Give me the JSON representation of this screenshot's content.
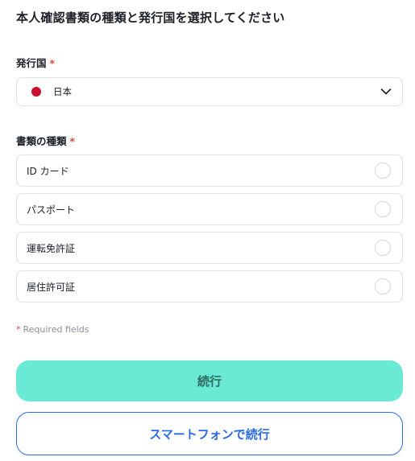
{
  "title": "本人確認書類の種類と発行国を選択してください",
  "country_field": {
    "label": "発行国",
    "required_mark": "*",
    "selected_value": "日本",
    "flag_icon": "japan-flag-icon",
    "flag_color": "#c8102e"
  },
  "document_field": {
    "label": "書類の種類",
    "required_mark": "*",
    "options": [
      {
        "label": "ID カード",
        "selected": false
      },
      {
        "label": "パスポート",
        "selected": false
      },
      {
        "label": "運転免許証",
        "selected": false
      },
      {
        "label": "居住許可証",
        "selected": false
      }
    ]
  },
  "required_note": {
    "star": "*",
    "text": "Required fields"
  },
  "buttons": {
    "continue_label": "続行",
    "smartphone_label": "スマートフォンで続行"
  },
  "colors": {
    "primary_button": "#6ae9d4",
    "secondary_accent": "#2c6be6",
    "required": "#e0453a"
  }
}
